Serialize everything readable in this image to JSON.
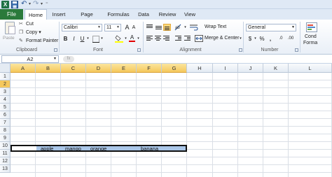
{
  "quick_access": {
    "app_icon": "excel-icon",
    "items": [
      "save-icon",
      "undo-icon",
      "redo-icon",
      "customize-icon"
    ]
  },
  "tabs": [
    {
      "label": "File"
    },
    {
      "label": "Home"
    },
    {
      "label": "Insert"
    },
    {
      "label": "Page Layout"
    },
    {
      "label": "Formulas"
    },
    {
      "label": "Data"
    },
    {
      "label": "Review"
    },
    {
      "label": "View"
    }
  ],
  "ribbon": {
    "clipboard": {
      "paste": "Paste",
      "cut": "Cut",
      "copy": "Copy",
      "format_painter": "Format Painter",
      "group": "Clipboard"
    },
    "font": {
      "name": "Calibri",
      "size": "11",
      "bold": "B",
      "italic": "I",
      "underline": "U",
      "grow": "A",
      "shrink": "A",
      "color": "A",
      "group": "Font"
    },
    "alignment": {
      "wrap_text": "Wrap Text",
      "merge_center": "Merge & Center",
      "group": "Alignment"
    },
    "number": {
      "format": "General",
      "currency": "$",
      "percent": "%",
      "comma": ",",
      "dec_inc": ".0",
      "dec_dec": ".00",
      "group": "Number"
    },
    "styles": {
      "cond_line1": "Cond",
      "cond_line2": "Forma"
    }
  },
  "formula_bar": {
    "name_box": "A2",
    "fx": "fx"
  },
  "grid": {
    "columns": [
      "A",
      "B",
      "C",
      "D",
      "E",
      "F",
      "G",
      "H",
      "I",
      "J",
      "K",
      "L"
    ],
    "rows": [
      "1",
      "2",
      "3",
      "4",
      "5",
      "6",
      "7",
      "8",
      "9",
      "10",
      "11",
      "12",
      "13"
    ],
    "active_row": "2",
    "cells": {
      "B2": "apple",
      "C2": "mango",
      "D2": "orange",
      "F2": "banana"
    }
  },
  "colors": {
    "file_tab": "#2a7a3b",
    "selection": "#a9c6e8",
    "header_highlight": "#f5c85c"
  }
}
